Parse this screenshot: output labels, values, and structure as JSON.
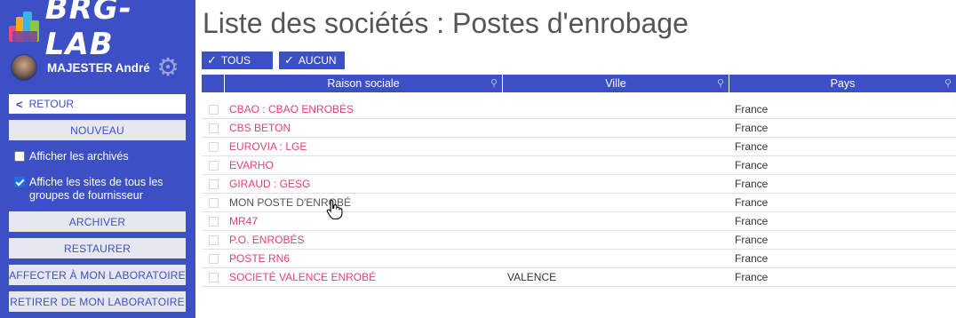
{
  "app": {
    "logo_text": "BRG-LAB"
  },
  "user": {
    "name": "MAJESTER André",
    "avatar_icon": "user-avatar",
    "settings_icon": "gear-icon"
  },
  "sidebar": {
    "back_label": "RETOUR",
    "new_label": "NOUVEAU",
    "show_archived": {
      "label": "Afficher les archivés",
      "checked": false
    },
    "show_all_sites": {
      "label_line1": "Affiche les sites de tous les",
      "label_line2": "groupes de fournisseur",
      "checked": true
    },
    "archive_label": "ARCHIVER",
    "restore_label": "RESTAURER",
    "assign_label": "AFFECTER À MON LABORATOIRE",
    "remove_label": "RETIRER DE MON LABORATOIRE"
  },
  "page": {
    "title": "Liste des sociétés : Postes d'enrobage"
  },
  "selection": {
    "all_label": "TOUS",
    "none_label": "AUCUN"
  },
  "table": {
    "columns": [
      "Raison sociale",
      "Ville",
      "Pays"
    ],
    "rows": [
      {
        "name": "CBAO : CBAO ENROBÉS",
        "city": "",
        "country": "France",
        "link": true
      },
      {
        "name": "CBS BETON",
        "city": "",
        "country": "France",
        "link": true
      },
      {
        "name": "EUROVIA : LGE",
        "city": "",
        "country": "France",
        "link": true
      },
      {
        "name": "EVARHO",
        "city": "",
        "country": "France",
        "link": true
      },
      {
        "name": "GIRAUD : GESG",
        "city": "",
        "country": "France",
        "link": true
      },
      {
        "name": "MON POSTE D'ENROBÉ",
        "city": "",
        "country": "France",
        "link": false
      },
      {
        "name": "MR47",
        "city": "",
        "country": "France",
        "link": true
      },
      {
        "name": "P.O. ENROBÉS",
        "city": "",
        "country": "France",
        "link": true
      },
      {
        "name": "POSTE RN6",
        "city": "",
        "country": "France",
        "link": true
      },
      {
        "name": "SOCIETÉ VALENCE ENROBÉ",
        "city": "VALENCE",
        "country": "France",
        "link": true
      }
    ]
  },
  "colors": {
    "accent": "#3d4fc4",
    "link": "#e0427a",
    "text": "#555555"
  }
}
